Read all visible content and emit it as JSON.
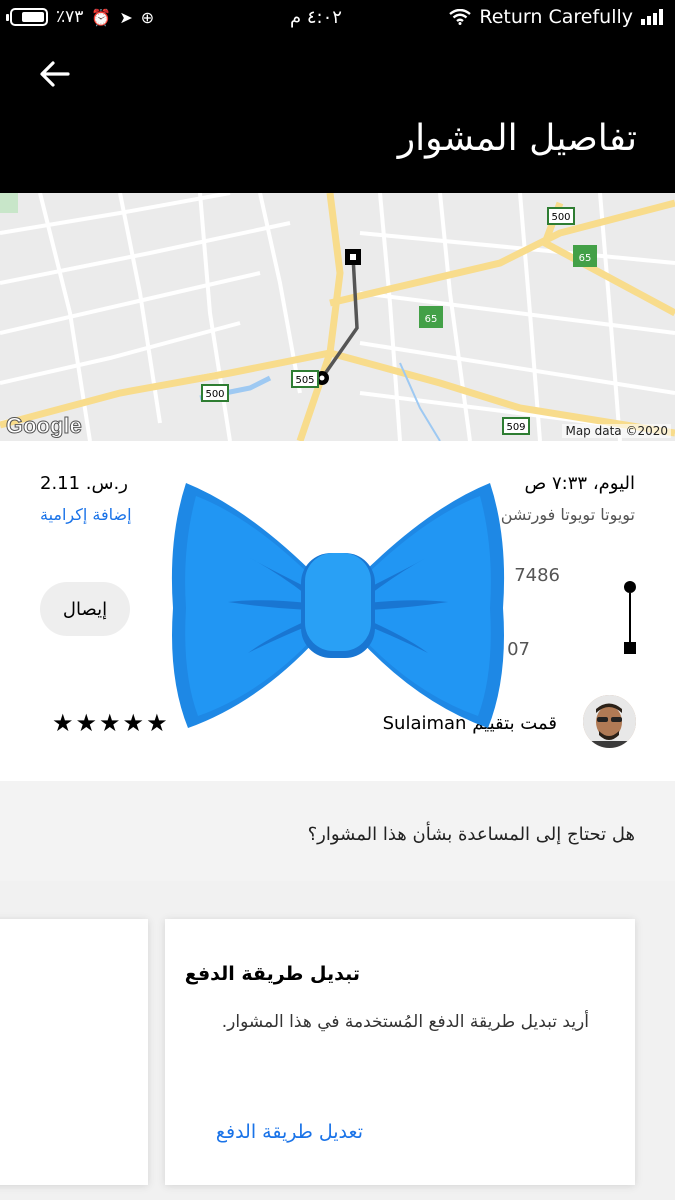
{
  "status_bar": {
    "battery_text": "٪٧٣",
    "battery_level": 0.73,
    "time": "٤:٠٢ م",
    "carrier": "Return Carefully"
  },
  "header": {
    "title": "تفاصيل المشوار"
  },
  "map": {
    "credit": "Map data ©2020",
    "logo": "Google",
    "road_shields": [
      "500",
      "65",
      "65",
      "500",
      "505",
      "509"
    ]
  },
  "trip": {
    "date": "اليوم، ٧:٣٣ ص",
    "car": "تويوتا تويوتا فورتشن",
    "fare": "ر.س. 2.11",
    "tip_label": "إضافة إكرامية",
    "pickup_partial": "7486",
    "dropoff_partial": "07",
    "receipt_label": "إيصال",
    "rating_label": "قمت بتقييم Sulaiman",
    "stars": 5,
    "stars_text": "★★★★★"
  },
  "help": {
    "question": "هل تحتاج إلى المساعدة بشأن هذا المشوار؟"
  },
  "card": {
    "title": "تبديل طريقة الدفع",
    "body": "أريد تبديل طريقة الدفع المُستخدمة في هذا المشوار.",
    "link": "تعديل طريقة الدفع"
  },
  "colors": {
    "link_blue": "#1a73e8",
    "bowtie_blue": "#2196f3",
    "header_bg": "#000000"
  }
}
